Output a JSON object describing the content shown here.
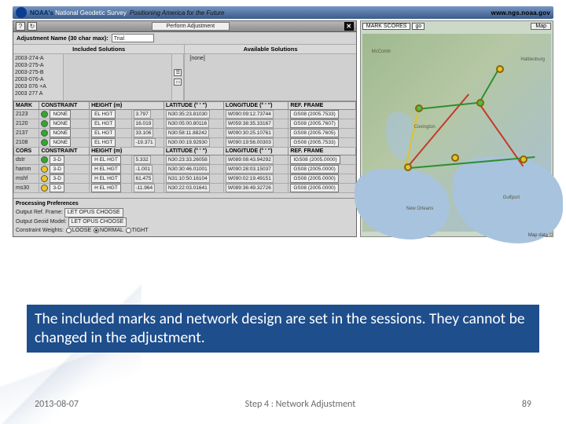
{
  "noaa": {
    "brand_b": "NOAA's",
    "brand_t": "National Geodetic Survey",
    "tag": "Positioning America for the Future",
    "url": "www.ngs.noaa.gov"
  },
  "opus": {
    "titlebar": "Perform Adjustment",
    "adj_label": "Adjustment Name (30 char max):",
    "adj_value": "Trial",
    "included_h": "Included Solutions",
    "available_h": "Available Solutions",
    "none_label": "[none]",
    "sessions": [
      "2003-274-A",
      "2003-275-A",
      "2003-275-B",
      "2003-076-A",
      "2003 076 +A",
      "2003 277 A"
    ],
    "mark_headers": {
      "mark": "MARK",
      "constraint": "CONSTRAINT",
      "hgt": "HEIGHT (m)",
      "lat": "LATITUDE (° ' \")",
      "lon": "LONGITUDE (° ' \")",
      "ref": "REF. FRAME"
    },
    "cors_headers": {
      "mark": "CORS",
      "constraint": "CONSTRAINT",
      "hgt": "HEIGHT (m)",
      "lat": "LATITUDE (° ' \")",
      "lon": "LONGITUDE (° ' \")",
      "ref": "REF. FRAME"
    },
    "marks": [
      {
        "mark": "2123",
        "c": "NONE",
        "h": "EL HGT",
        "hv": "3.797",
        "lat": "N30:35:23.81030",
        "lon": "W090:09:12.73744",
        "ref": "GS08 (2005.7533)"
      },
      {
        "mark": "2120",
        "c": "NONE",
        "h": "EL HGT",
        "hv": "16.019",
        "lat": "N30:05:00.80116",
        "lon": "W059:38:35.33167",
        "ref": "GS08 (2005.7607)"
      },
      {
        "mark": "2137",
        "c": "NONE",
        "h": "EL HGT",
        "hv": "33.106",
        "lat": "N30:58:11.88242",
        "lon": "W090:30:25.10761",
        "ref": "GS08 (2005.7605)"
      },
      {
        "mark": "2108",
        "c": "NONE",
        "h": "EL HGT",
        "hv": "-19.371",
        "lat": "N30:00:19.92930",
        "lon": "W090:19:56.00303",
        "ref": "GS08 (2005.7533)"
      }
    ],
    "cors": [
      {
        "mark": "dstr",
        "st": "g",
        "c": "3-D",
        "h": "H EL HGT",
        "hv": "5.332",
        "lat": "N30:23:33.26058",
        "lon": "W089:08:43.94292",
        "ref": "IGS08 (2005.0000)"
      },
      {
        "mark": "hamm",
        "st": "y",
        "c": "3-D",
        "h": "H EL HGT",
        "hv": "-1.001",
        "lat": "N30:30:46.01001",
        "lon": "W090:28:03.15037",
        "ref": "GS08 (2005.0000)"
      },
      {
        "mark": "mshf",
        "st": "y",
        "c": "3-D",
        "h": "H EL HGT",
        "hv": "61.475",
        "lat": "N31:10:50.16104",
        "lon": "W090:02:19.49151",
        "ref": "GS08 (2005.0000)"
      },
      {
        "mark": "ms30",
        "st": "y",
        "c": "3-D",
        "h": "H EL HGT",
        "hv": "-11.964",
        "lat": "N30:22:03.01641",
        "lon": "W089:36:49.32726",
        "ref": "GS08 (2005.0000)"
      }
    ],
    "prefs": {
      "hdr": "Processing Preferences",
      "l1": "Output Ref. Frame:",
      "v1": "LET OPUS CHOOSE",
      "l2": "Output Geoid Model:",
      "v2": "LET OPUS CHOOSE",
      "l3": "Constraint Weights:",
      "o1": "LOOSE",
      "o2": "NORMAL",
      "o3": "TIGHT"
    }
  },
  "map": {
    "sel": "MARK SCORES",
    "go": "go",
    "btn": "Map",
    "towns": [
      "New Orleans",
      "Covington",
      "McComb",
      "Hattiesburg",
      "Gulfport"
    ],
    "foot": "Map data ©"
  },
  "caption": "The included marks and network design are set in the sessions. They cannot be changed in the adjustment.",
  "footer": {
    "date": "2013-08-07",
    "mid": "Step 4 : Network Adjustment",
    "num": "89"
  }
}
